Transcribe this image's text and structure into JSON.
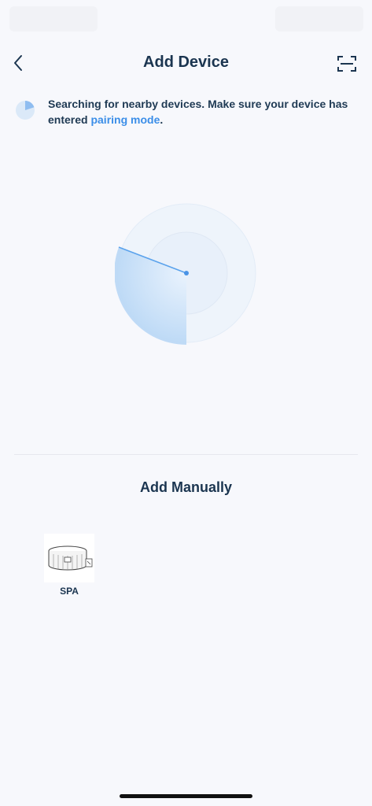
{
  "nav": {
    "title": "Add Device"
  },
  "notice": {
    "text": "Searching for nearby devices. Make sure your device has entered ",
    "link": "pairing mode",
    "suffix": "."
  },
  "manual": {
    "title": "Add Manually",
    "devices": [
      {
        "label": "SPA"
      }
    ]
  },
  "colors": {
    "accent": "#3b8ee8",
    "text": "#1b3550",
    "background": "#f7f8fc",
    "radar": "#5aa2ec"
  },
  "icons": {
    "back": "chevron-left-icon",
    "scan": "scan-icon",
    "spinner": "spinner-icon",
    "device": "spa-tub-icon"
  }
}
